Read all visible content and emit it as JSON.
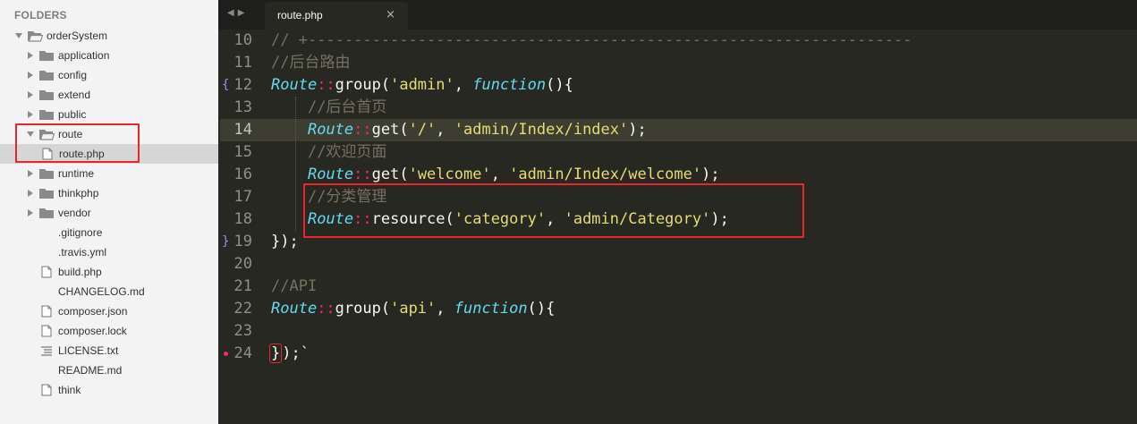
{
  "sidebar": {
    "header": "FOLDERS",
    "items": [
      {
        "label": "orderSystem",
        "type": "folder-open",
        "level": 0,
        "expanded": true
      },
      {
        "label": "application",
        "type": "folder",
        "level": 1
      },
      {
        "label": "config",
        "type": "folder",
        "level": 1
      },
      {
        "label": "extend",
        "type": "folder",
        "level": 1
      },
      {
        "label": "public",
        "type": "folder",
        "level": 1
      },
      {
        "label": "route",
        "type": "folder-open",
        "level": 1,
        "expanded": true
      },
      {
        "label": "route.php",
        "type": "file",
        "level": 2,
        "selected": true
      },
      {
        "label": "runtime",
        "type": "folder",
        "level": 1
      },
      {
        "label": "thinkphp",
        "type": "folder",
        "level": 1
      },
      {
        "label": "vendor",
        "type": "folder",
        "level": 1
      },
      {
        "label": ".gitignore",
        "type": "none",
        "level": 1
      },
      {
        "label": ".travis.yml",
        "type": "none",
        "level": 1
      },
      {
        "label": "build.php",
        "type": "file",
        "level": 1
      },
      {
        "label": "CHANGELOG.md",
        "type": "none",
        "level": 1
      },
      {
        "label": "composer.json",
        "type": "file",
        "level": 1
      },
      {
        "label": "composer.lock",
        "type": "file",
        "level": 1
      },
      {
        "label": "LICENSE.txt",
        "type": "lines",
        "level": 1
      },
      {
        "label": "README.md",
        "type": "none",
        "level": 1
      },
      {
        "label": "think",
        "type": "file",
        "level": 1
      }
    ]
  },
  "tabbar": {
    "nav_left": "◀",
    "nav_right": "▶",
    "tab_label": "route.php",
    "close_glyph": "×"
  },
  "editor": {
    "current_line": 14,
    "lines": [
      {
        "no": "10",
        "tokens": [
          {
            "t": "// +------------------------------------------------------------------",
            "c": "c-comment"
          }
        ]
      },
      {
        "no": "11",
        "tokens": [
          {
            "t": "//后台路由",
            "c": "c-comment"
          }
        ]
      },
      {
        "no": "12",
        "fold": "{",
        "tokens": [
          {
            "t": "Route",
            "c": "c-class"
          },
          {
            "t": "::",
            "c": "c-op"
          },
          {
            "t": "group(",
            "c": "c-plain"
          },
          {
            "t": "'admin'",
            "c": "c-str"
          },
          {
            "t": ", ",
            "c": "c-plain"
          },
          {
            "t": "function",
            "c": "c-kw"
          },
          {
            "t": "(){",
            "c": "c-plain"
          }
        ]
      },
      {
        "no": "13",
        "tokens": [
          {
            "t": "    ",
            "c": "c-plain"
          },
          {
            "t": "//后台首页",
            "c": "c-comment"
          }
        ]
      },
      {
        "no": "14",
        "tokens": [
          {
            "t": "    ",
            "c": "c-plain"
          },
          {
            "t": "Route",
            "c": "c-class"
          },
          {
            "t": "::",
            "c": "c-op"
          },
          {
            "t": "get(",
            "c": "c-plain"
          },
          {
            "t": "'/'",
            "c": "c-str"
          },
          {
            "t": ", ",
            "c": "c-plain"
          },
          {
            "t": "'admin/Index/index'",
            "c": "c-str"
          },
          {
            "t": ");",
            "c": "c-plain"
          }
        ]
      },
      {
        "no": "15",
        "tokens": [
          {
            "t": "    ",
            "c": "c-plain"
          },
          {
            "t": "//欢迎页面",
            "c": "c-comment"
          }
        ]
      },
      {
        "no": "16",
        "tokens": [
          {
            "t": "    ",
            "c": "c-plain"
          },
          {
            "t": "Route",
            "c": "c-class"
          },
          {
            "t": "::",
            "c": "c-op"
          },
          {
            "t": "get(",
            "c": "c-plain"
          },
          {
            "t": "'welcome'",
            "c": "c-str"
          },
          {
            "t": ", ",
            "c": "c-plain"
          },
          {
            "t": "'admin/Index/welcome'",
            "c": "c-str"
          },
          {
            "t": ");",
            "c": "c-plain"
          }
        ]
      },
      {
        "no": "17",
        "tokens": [
          {
            "t": "    ",
            "c": "c-plain"
          },
          {
            "t": "//分类管理",
            "c": "c-comment"
          }
        ]
      },
      {
        "no": "18",
        "tokens": [
          {
            "t": "    ",
            "c": "c-plain"
          },
          {
            "t": "Route",
            "c": "c-class"
          },
          {
            "t": "::",
            "c": "c-op"
          },
          {
            "t": "resource(",
            "c": "c-plain"
          },
          {
            "t": "'category'",
            "c": "c-str"
          },
          {
            "t": ", ",
            "c": "c-plain"
          },
          {
            "t": "'admin/Category'",
            "c": "c-str"
          },
          {
            "t": ");",
            "c": "c-plain"
          }
        ]
      },
      {
        "no": "19",
        "fold": "}",
        "tokens": [
          {
            "t": "});",
            "c": "c-plain"
          }
        ]
      },
      {
        "no": "20",
        "tokens": []
      },
      {
        "no": "21",
        "tokens": [
          {
            "t": "//API",
            "c": "c-comment"
          }
        ]
      },
      {
        "no": "22",
        "tokens": [
          {
            "t": "Route",
            "c": "c-class"
          },
          {
            "t": "::",
            "c": "c-op"
          },
          {
            "t": "group(",
            "c": "c-plain"
          },
          {
            "t": "'api'",
            "c": "c-str"
          },
          {
            "t": ", ",
            "c": "c-plain"
          },
          {
            "t": "function",
            "c": "c-kw"
          },
          {
            "t": "(){",
            "c": "c-plain"
          }
        ]
      },
      {
        "no": "23",
        "tokens": []
      },
      {
        "no": "24",
        "dot": true,
        "tokens": [
          {
            "t": "}",
            "c": "c-plain",
            "box": true
          },
          {
            "t": ");`",
            "c": "c-plain"
          }
        ]
      }
    ]
  },
  "colors": {
    "accent_red": "#e8262e",
    "editor_bg": "#272822",
    "sidebar_bg": "#f3f3f3"
  }
}
